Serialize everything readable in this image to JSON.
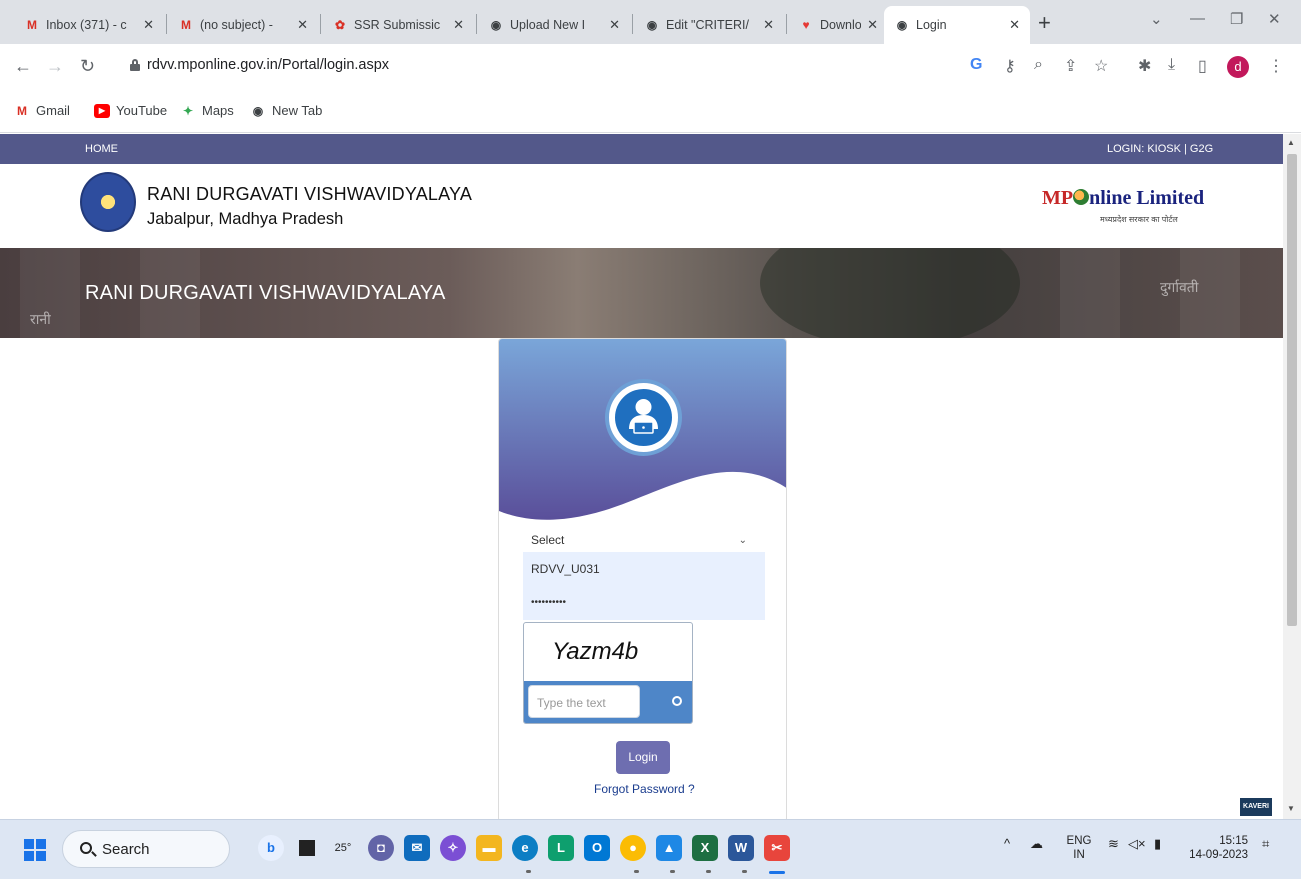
{
  "browser": {
    "tabs": [
      {
        "title": "Inbox (371) - c",
        "icon": "gmail-icon",
        "active": false
      },
      {
        "title": "(no subject) - ",
        "icon": "gmail-icon",
        "active": false
      },
      {
        "title": "SSR Submissic",
        "icon": "ssr-icon",
        "active": false
      },
      {
        "title": "Upload New I",
        "icon": "globe-icon",
        "active": false
      },
      {
        "title": "Edit \"CRITERI/",
        "icon": "globe-icon",
        "active": false
      },
      {
        "title": "Download file",
        "icon": "heart-icon",
        "active": false
      },
      {
        "title": "Login",
        "icon": "globe-icon",
        "active": true
      }
    ],
    "url": "rdvv.mponline.gov.in/Portal/login.aspx",
    "profile_initial": "d",
    "bookmarks": [
      {
        "label": "Gmail",
        "icon": "gmail-icon"
      },
      {
        "label": "YouTube",
        "icon": "youtube-icon"
      },
      {
        "label": "Maps",
        "icon": "maps-icon"
      },
      {
        "label": "New Tab",
        "icon": "globe-icon"
      }
    ]
  },
  "page": {
    "topnav": {
      "home": "HOME",
      "login": "LOGIN: KIOSK | G2G"
    },
    "header": {
      "university": "RANI DURGAVATI VISHWAVIDYALAYA",
      "location": "Jabalpur, Madhya Pradesh",
      "partner_logo": {
        "mp": "MP",
        "online": "nline Limited",
        "tagline": "मध्यप्रदेश सरकार का पोर्टल"
      }
    },
    "banner": {
      "title": "RANI DURGAVATI VISHWAVIDYALAYA",
      "sign_left": "रानी",
      "sign_right": "दुर्गावती"
    },
    "login": {
      "role_select": "Select",
      "username": "RDVV_U031",
      "password": "••••••••••",
      "captcha_text": "Yazm4b",
      "captcha_placeholder": "Type the text",
      "login_button": "Login",
      "forgot_link": "Forgot Password ?"
    },
    "kaveri_badge": "KAVERI"
  },
  "taskbar": {
    "search_label": "Search",
    "weather": "25°",
    "language": "ENG",
    "region": "IN",
    "time": "15:15",
    "date": "14-09-2023"
  },
  "colors": {
    "nav_bar": "#53588a",
    "card_gradient_top": "#7aa6d9",
    "card_gradient_bottom": "#5a4f9a",
    "login_button": "#6e6eb0",
    "captcha_bar": "#4e86c8",
    "link": "#1a3c8e"
  }
}
